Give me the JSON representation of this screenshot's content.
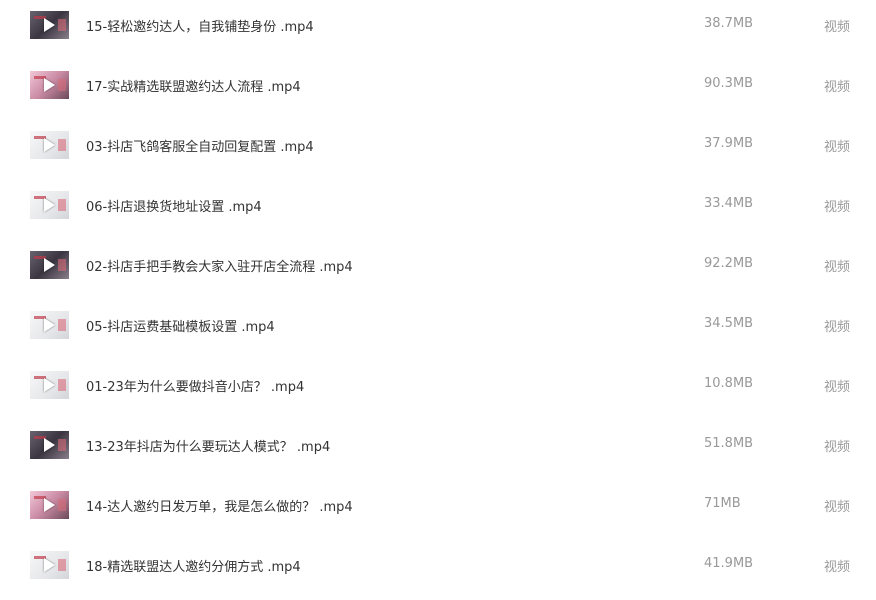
{
  "files": [
    {
      "name": "15-轻松邀约达人，自我铺垫身份 .mp4",
      "size": "38.7MB",
      "type": "视频",
      "thumb": "dark"
    },
    {
      "name": "17-实战精选联盟邀约达人流程 .mp4",
      "size": "90.3MB",
      "type": "视频",
      "thumb": "pink"
    },
    {
      "name": "03-抖店飞鸽客服全自动回复配置 .mp4",
      "size": "37.9MB",
      "type": "视频",
      "thumb": "light"
    },
    {
      "name": "06-抖店退换货地址设置 .mp4",
      "size": "33.4MB",
      "type": "视频",
      "thumb": "light"
    },
    {
      "name": "02-抖店手把手教会大家入驻开店全流程 .mp4",
      "size": "92.2MB",
      "type": "视频",
      "thumb": "dark"
    },
    {
      "name": "05-抖店运费基础模板设置 .mp4",
      "size": "34.5MB",
      "type": "视频",
      "thumb": "light"
    },
    {
      "name": "01-23年为什么要做抖音小店？ .mp4",
      "size": "10.8MB",
      "type": "视频",
      "thumb": "light"
    },
    {
      "name": "13-23年抖店为什么要玩达人模式？ .mp4",
      "size": "51.8MB",
      "type": "视频",
      "thumb": "dark"
    },
    {
      "name": "14-达人邀约日发万单，我是怎么做的？ .mp4",
      "size": "71MB",
      "type": "视频",
      "thumb": "pink"
    },
    {
      "name": "18-精选联盟达人邀约分佣方式 .mp4",
      "size": "41.9MB",
      "type": "视频",
      "thumb": "light"
    }
  ]
}
